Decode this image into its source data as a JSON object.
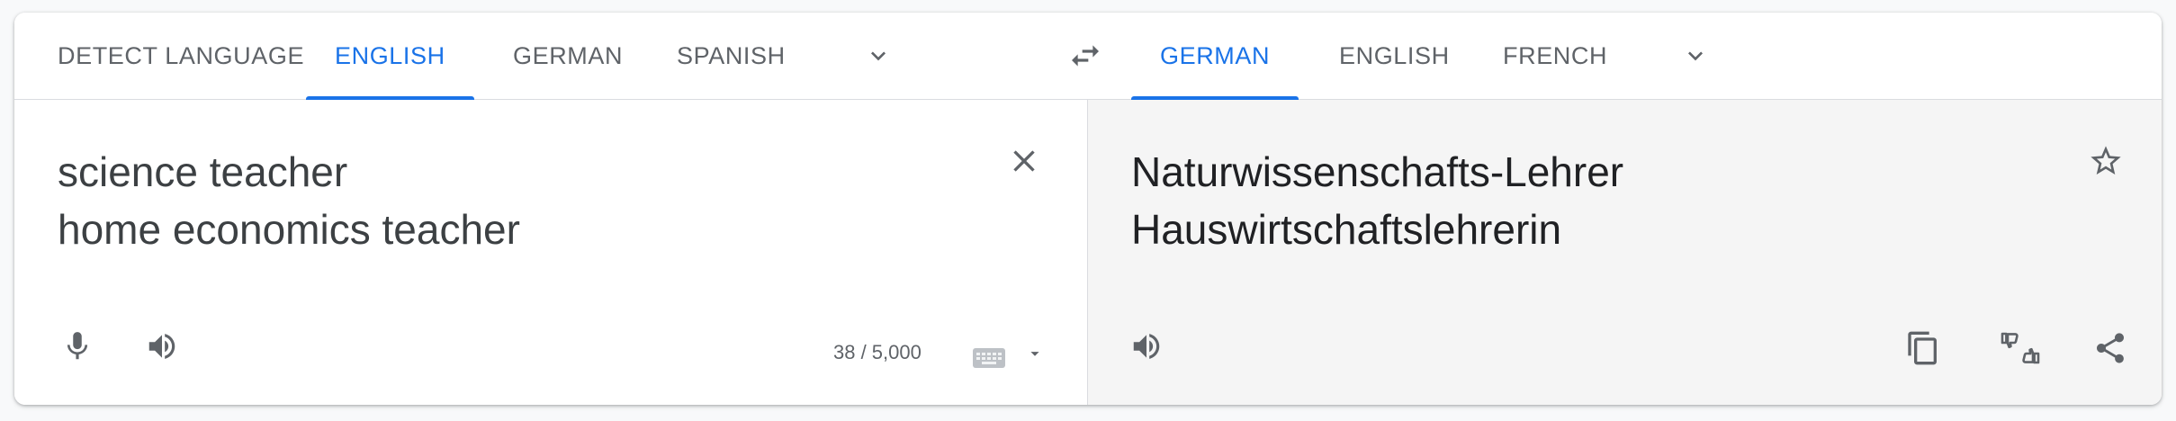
{
  "source_tabs": [
    "DETECT LANGUAGE",
    "ENGLISH",
    "GERMAN",
    "SPANISH"
  ],
  "target_tabs": [
    "GERMAN",
    "ENGLISH",
    "FRENCH"
  ],
  "source_text": "science teacher\nhome economics teacher",
  "translated_text": "Naturwissenschafts-Lehrer\nHauswirtschaftslehrerin",
  "char_counter": "38 / 5,000",
  "active_source": "ENGLISH",
  "active_target": "GERMAN",
  "colors": {
    "accent": "#1a73e8",
    "icon": "#5f6368",
    "output_bg": "#f5f5f5"
  }
}
